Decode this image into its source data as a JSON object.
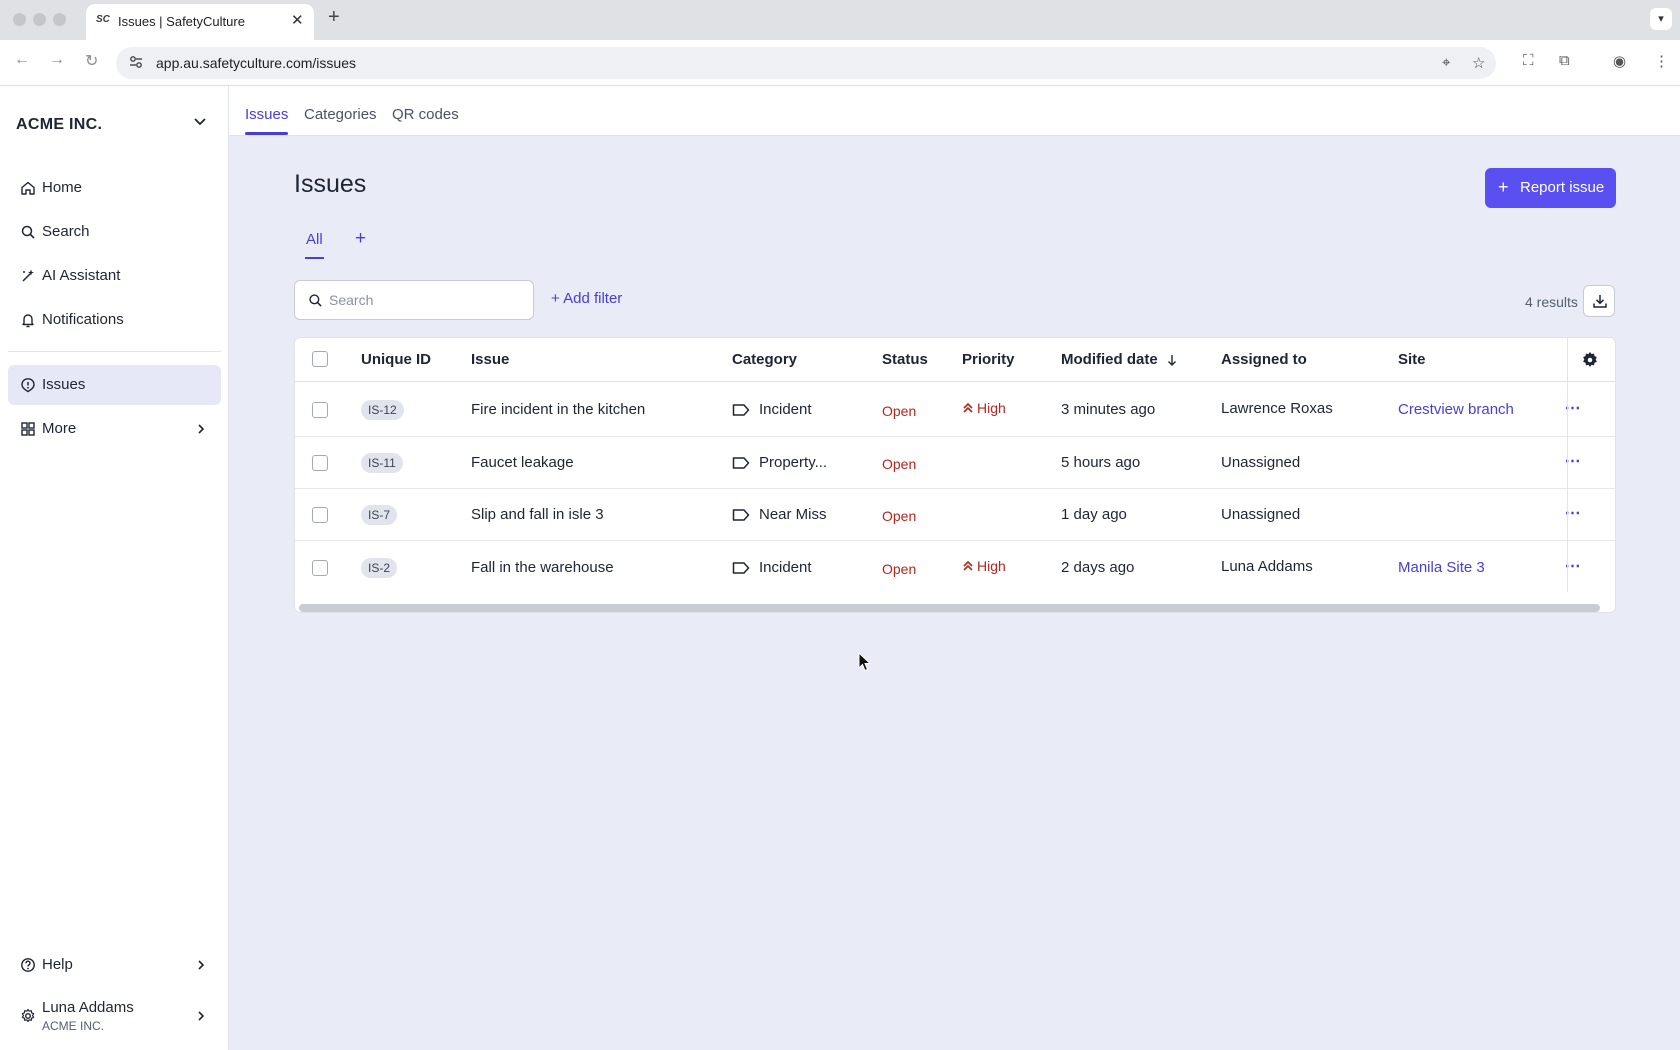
{
  "browser": {
    "tab_title": "Issues | SafetyCulture",
    "favicon_text": "SC",
    "url": "app.au.safetyculture.com/issues"
  },
  "sidebar": {
    "org_name": "ACME INC.",
    "items": [
      {
        "label": "Home",
        "icon": "home-icon"
      },
      {
        "label": "Search",
        "icon": "search-icon"
      },
      {
        "label": "AI Assistant",
        "icon": "ai-sparkle-icon"
      },
      {
        "label": "Notifications",
        "icon": "bell-icon"
      },
      {
        "label": "Issues",
        "icon": "issue-icon",
        "active": true
      },
      {
        "label": "More",
        "icon": "grid-icon"
      }
    ],
    "help_label": "Help",
    "user": {
      "name": "Luna Addams",
      "org": "ACME INC."
    }
  },
  "topnav": {
    "tabs": [
      "Issues",
      "Categories",
      "QR codes"
    ],
    "active": "Issues"
  },
  "page": {
    "title": "Issues",
    "report_button": "Report issue",
    "view_tab": "All",
    "search_placeholder": "Search",
    "add_filter": "Add filter",
    "results": "4 results"
  },
  "table": {
    "headers": [
      "Unique ID",
      "Issue",
      "Category",
      "Status",
      "Priority",
      "Modified date",
      "Assigned to",
      "Site"
    ],
    "sort_column": "Modified date",
    "rows": [
      {
        "id": "IS-12",
        "issue": "Fire incident in the kitchen",
        "category": "Incident",
        "status": "Open",
        "priority": "High",
        "modified": "3 minutes ago",
        "assigned": "Lawrence Roxas",
        "site": "Crestview branch"
      },
      {
        "id": "IS-11",
        "issue": "Faucet leakage",
        "category": "Property...",
        "status": "Open",
        "priority": "",
        "modified": "5 hours ago",
        "assigned": "Unassigned",
        "site": ""
      },
      {
        "id": "IS-7",
        "issue": "Slip and fall in isle 3",
        "category": "Near Miss",
        "status": "Open",
        "priority": "",
        "modified": "1 day ago",
        "assigned": "Unassigned",
        "site": ""
      },
      {
        "id": "IS-2",
        "issue": "Fall in the warehouse",
        "category": "Incident",
        "status": "Open",
        "priority": "High",
        "modified": "2 days ago",
        "assigned": "Luna Addams",
        "site": "Manila Site 3"
      }
    ]
  },
  "colors": {
    "accent": "#5a4ff0",
    "link": "#4740d4",
    "status_open": "#b3261e",
    "background": "#e9ebf6"
  }
}
